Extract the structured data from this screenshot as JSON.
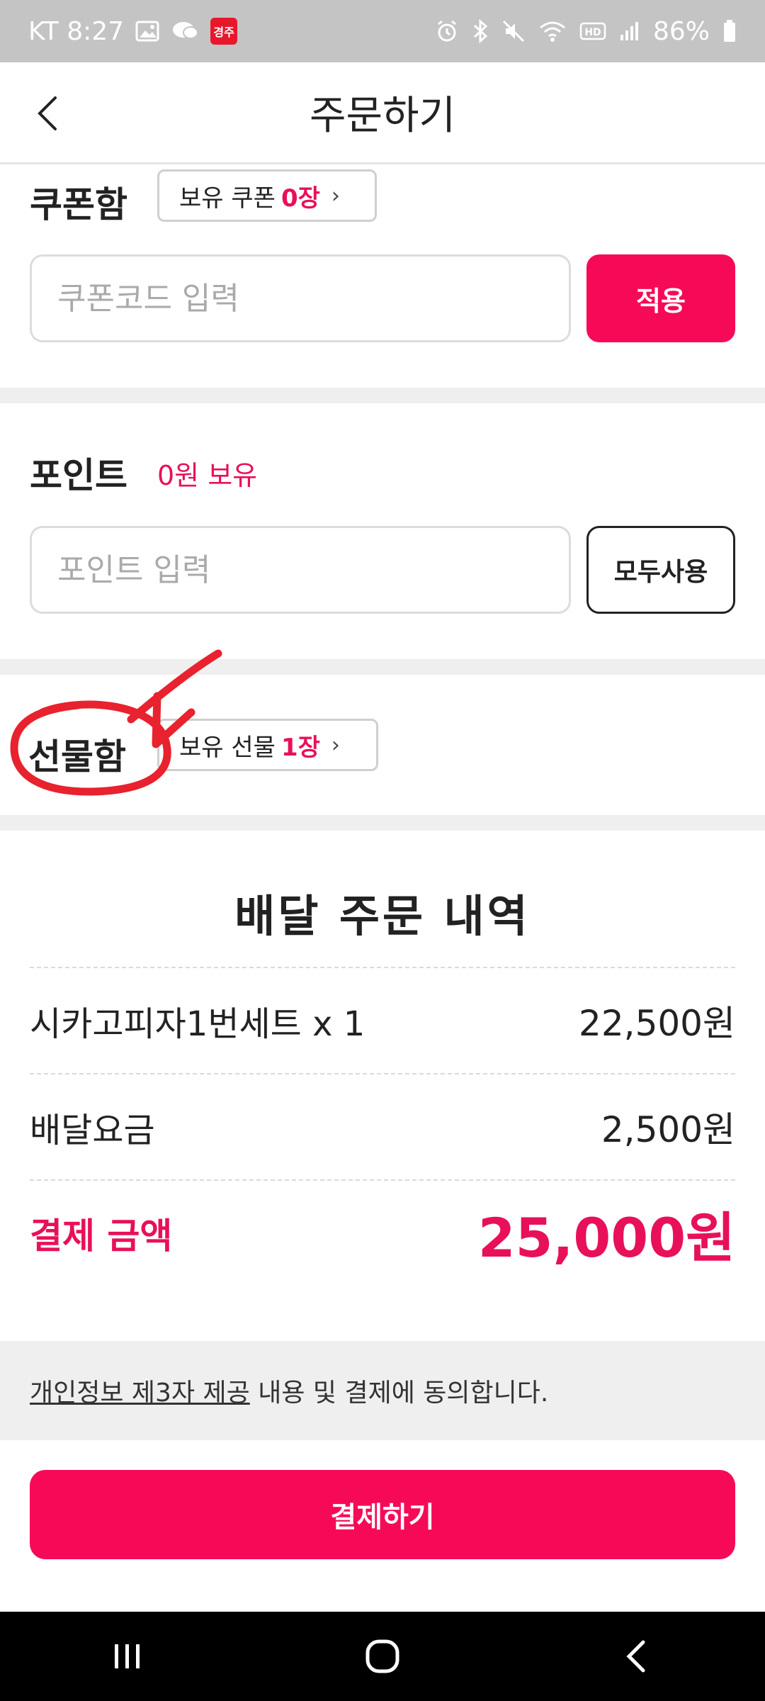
{
  "status_bar": {
    "carrier_time": "KT 8:27",
    "app_badge": "경주",
    "battery": "86%",
    "icons": [
      "image-icon",
      "chat-icon",
      "app-badge",
      "alarm-icon",
      "bluetooth-icon",
      "mute-icon",
      "wifi-icon",
      "hd-icon",
      "signal-icon",
      "battery-icon"
    ]
  },
  "header": {
    "title": "주문하기",
    "back_icon": "chevron-left-icon"
  },
  "coupon": {
    "label": "쿠폰함",
    "pill_prefix": "보유 쿠폰",
    "pill_count": "0장",
    "input_placeholder": "쿠폰코드 입력",
    "apply_label": "적용"
  },
  "points": {
    "label": "포인트",
    "held": "0원 보유",
    "input_placeholder": "포인트 입력",
    "use_all_label": "모두사용"
  },
  "gift": {
    "label": "선물함",
    "pill_prefix": "보유 선물",
    "pill_count": "1장"
  },
  "summary": {
    "title": "배달 주문 내역",
    "rows": [
      {
        "label": "시카고피자1번세트 x 1",
        "value": "22,500원"
      },
      {
        "label": "배달요금",
        "value": "2,500원"
      }
    ],
    "total_label": "결제 금액",
    "total_value": "25,000원"
  },
  "consent": {
    "link_text": "개인정보 제3자 제공",
    "rest_text": " 내용 및 결제에 동의합니다."
  },
  "pay_button": "결제하기",
  "nav": {
    "icons": [
      "recent-apps-icon",
      "home-icon",
      "back-icon"
    ]
  },
  "colors": {
    "accent": "#f60a57",
    "annotation": "#e8222e",
    "divider": "#efefef"
  }
}
